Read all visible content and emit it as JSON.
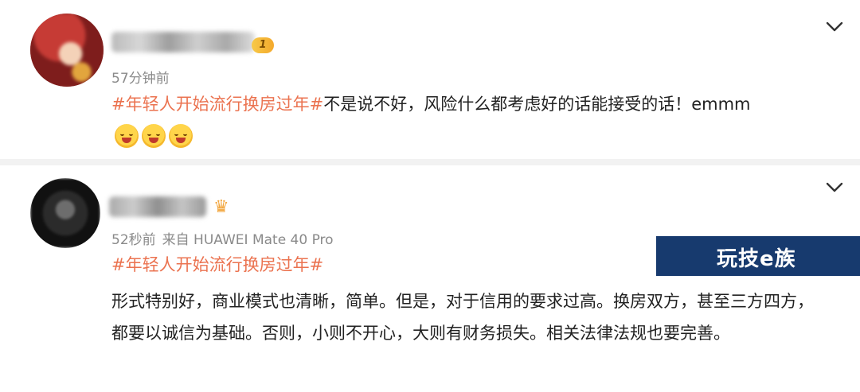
{
  "comments": [
    {
      "username": "",
      "badge": "1",
      "time": "57分钟前",
      "device": "",
      "hashtag": "#年轻人开始流行换房过年#",
      "text": "不是说不好，风险什么都考虑好的话能接受的话！emmm",
      "emojis": [
        "laugh-emoji",
        "laugh-emoji",
        "laugh-emoji"
      ]
    },
    {
      "username": "",
      "time": "52秒前",
      "device": "来自 HUAWEI Mate 40 Pro",
      "hashtag": "#年轻人开始流行换房过年#",
      "text": "形式特别好，商业模式也清晰，简单。但是，对于信用的要求过高。换房双方，甚至三方四方，都要以诚信为基础。否则，小则不开心，大则有财务损失。相关法律法规也要完善。"
    }
  ],
  "watermark": "玩技e族",
  "colors": {
    "hashtag": "#eb7350",
    "meta": "#8a8a8a",
    "watermark_bg": "#173a6e"
  }
}
